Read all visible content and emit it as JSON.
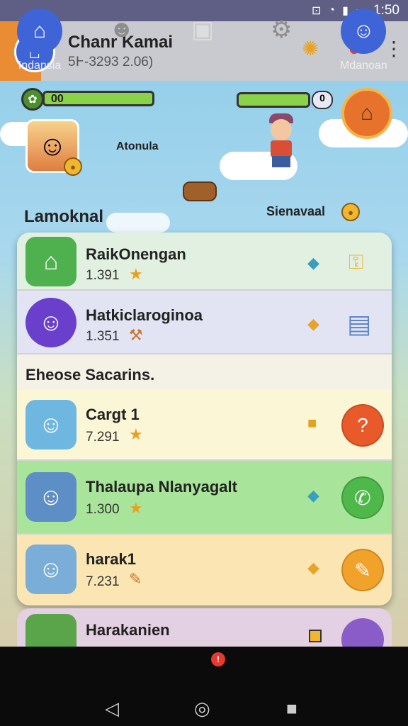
{
  "status": {
    "time": "1:50"
  },
  "header": {
    "title": "Chanr Kamai",
    "subtitle": "5Ͱ-3293 2.06)"
  },
  "hud": {
    "level_text": "00",
    "right_pill": "0",
    "map_label_1": "Atonula",
    "map_label_2": "Lamoknal",
    "map_label_3": "Sienavaal"
  },
  "list": {
    "items": [
      {
        "name": "RaikOnengan",
        "value": "1.391",
        "bg": "#e1f0e0",
        "thumb_bg": "#4fb04e",
        "action_bg": "transparent"
      },
      {
        "name": "Hatkiclaroginoa",
        "value": "1.351",
        "bg": "#e2e4f4",
        "thumb_bg": "#6a3fcc",
        "action_bg": "transparent"
      },
      {
        "name": "Cargt 1",
        "value": "7.291",
        "bg": "#fbf7d6",
        "thumb_bg": "#6eb7e0",
        "action_bg": "#e95a2b"
      },
      {
        "name": "Thalaupa Nlanyagalt",
        "value": "1.300",
        "bg": "#a9e49b",
        "thumb_bg": "#5e8ec6",
        "action_bg": "#4fb84a"
      },
      {
        "name": "harak1",
        "value": "7.231",
        "bg": "#fbe6b3",
        "thumb_bg": "#7aaed8",
        "action_bg": "#f0a22a"
      }
    ],
    "section_title": "Eheose Sacarins.",
    "partial_name": "Harakanien"
  },
  "nav": {
    "left_label": "Indansia",
    "right_label": "Mdanoan"
  },
  "colors": {
    "accent": "#3e64d8",
    "header": "#c9c9d0",
    "panel": "#f4f1e6"
  }
}
